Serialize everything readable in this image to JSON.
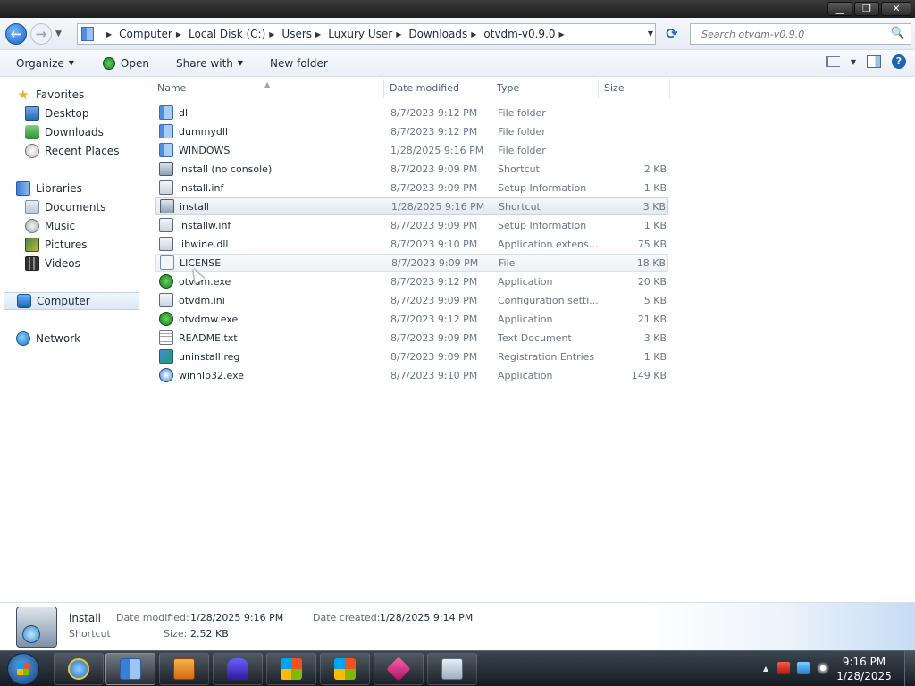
{
  "window": {
    "minimize_glyph": "▁",
    "maximize_glyph": "❐",
    "close_glyph": "✕"
  },
  "address": {
    "breadcrumbs": [
      "Computer",
      "Local Disk (C:)",
      "Users",
      "Luxury User",
      "Downloads",
      "otvdm-v0.9.0"
    ],
    "search_placeholder": "Search otvdm-v0.9.0"
  },
  "toolbar": {
    "organize": "Organize",
    "open": "Open",
    "share_with": "Share with",
    "new_folder": "New folder"
  },
  "nav": {
    "favorites": "Favorites",
    "desktop": "Desktop",
    "downloads": "Downloads",
    "recent_places": "Recent Places",
    "libraries": "Libraries",
    "documents": "Documents",
    "music": "Music",
    "pictures": "Pictures",
    "videos": "Videos",
    "computer": "Computer",
    "network": "Network"
  },
  "columns": {
    "name": "Name",
    "date_modified": "Date modified",
    "type": "Type",
    "size": "Size"
  },
  "files": [
    {
      "name": "dll",
      "date": "8/7/2023 9:12 PM",
      "type": "File folder",
      "size": "",
      "icon": "folder-icon"
    },
    {
      "name": "dummydll",
      "date": "8/7/2023 9:12 PM",
      "type": "File folder",
      "size": "",
      "icon": "folder-icon"
    },
    {
      "name": "WINDOWS",
      "date": "1/28/2025 9:16 PM",
      "type": "File folder",
      "size": "",
      "icon": "folder-icon"
    },
    {
      "name": "install (no console)",
      "date": "8/7/2023 9:09 PM",
      "type": "Shortcut",
      "size": "2 KB",
      "icon": "shortcut-icon"
    },
    {
      "name": "install.inf",
      "date": "8/7/2023 9:09 PM",
      "type": "Setup Information",
      "size": "1 KB",
      "icon": "setup-info-icon"
    },
    {
      "name": "install",
      "date": "1/28/2025 9:16 PM",
      "type": "Shortcut",
      "size": "3 KB",
      "icon": "shortcut-icon"
    },
    {
      "name": "installw.inf",
      "date": "8/7/2023 9:09 PM",
      "type": "Setup Information",
      "size": "1 KB",
      "icon": "setup-info-icon"
    },
    {
      "name": "libwine.dll",
      "date": "8/7/2023 9:10 PM",
      "type": "Application extensi...",
      "size": "75 KB",
      "icon": "dll-icon"
    },
    {
      "name": "LICENSE",
      "date": "8/7/2023 9:09 PM",
      "type": "File",
      "size": "18 KB",
      "icon": "file-icon"
    },
    {
      "name": "otvdm.exe",
      "date": "8/7/2023 9:12 PM",
      "type": "Application",
      "size": "20 KB",
      "icon": "application-icon"
    },
    {
      "name": "otvdm.ini",
      "date": "8/7/2023 9:09 PM",
      "type": "Configuration setti...",
      "size": "5 KB",
      "icon": "config-icon"
    },
    {
      "name": "otvdmw.exe",
      "date": "8/7/2023 9:12 PM",
      "type": "Application",
      "size": "21 KB",
      "icon": "application-icon"
    },
    {
      "name": "README.txt",
      "date": "8/7/2023 9:09 PM",
      "type": "Text Document",
      "size": "3 KB",
      "icon": "text-document-icon"
    },
    {
      "name": "uninstall.reg",
      "date": "8/7/2023 9:09 PM",
      "type": "Registration Entries",
      "size": "1 KB",
      "icon": "registry-icon"
    },
    {
      "name": "winhlp32.exe",
      "date": "8/7/2023 9:10 PM",
      "type": "Application",
      "size": "149 KB",
      "icon": "help-app-icon"
    }
  ],
  "details": {
    "name": "install",
    "type": "Shortcut",
    "date_modified_label": "Date modified:",
    "date_modified": "1/28/2025 9:16 PM",
    "date_created_label": "Date created:",
    "date_created": "1/28/2025 9:14 PM",
    "size_label": "Size:",
    "size": "2.52 KB"
  },
  "clock": {
    "time": "9:16 PM",
    "date": "1/28/2025"
  }
}
